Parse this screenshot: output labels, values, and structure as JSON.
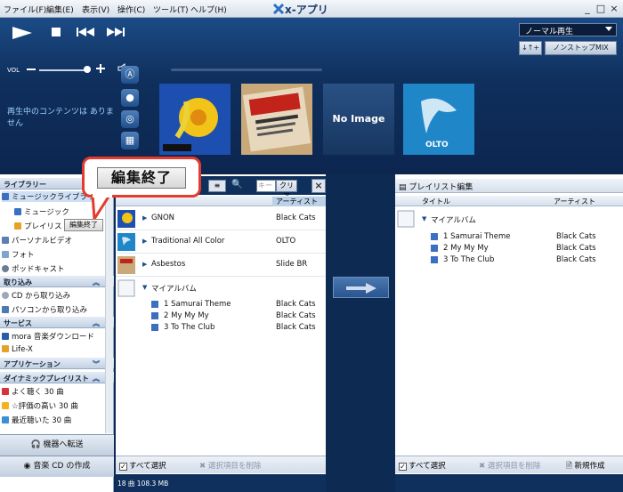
{
  "menubar": {
    "items": [
      "ファイル(F)",
      "編集(E)",
      "表示(V)",
      "操作(C)",
      "ツール(T)",
      "ヘルプ(H)"
    ],
    "app_title": "x-アプリ",
    "window_buttons": [
      "_",
      "□",
      "×"
    ]
  },
  "player": {
    "vol_label": "VOL",
    "play_mode": "ノーマル再生",
    "shuffle_label": "↓↑+",
    "nonstop_label": "ノンストップMIX",
    "now_playing": "再生中のコンテンツは ありません",
    "no_image": "No Image",
    "olto_label": "OLTO"
  },
  "sidebar": {
    "library_header": "ライブラリー",
    "library_items": [
      "ミュージックライブラリー",
      "ミュージック",
      "プレイリスト",
      "パーソナルビデオ",
      "フォト",
      "ポッドキャスト"
    ],
    "import_header": "取り込み",
    "import_items": [
      "CD から取り込み",
      "パソコンから取り込み"
    ],
    "service_header": "サービス",
    "service_items": [
      "mora 音楽ダウンロード",
      "Life-X"
    ],
    "apps_header": "アプリケーション",
    "dynamic_header": "ダイナミックプレイリスト",
    "dynamic_items": [
      "よく聴く 30 曲",
      "☆評価の高い 30 曲",
      "最近聴いた 30 曲"
    ],
    "transfer_button": "機器へ転送",
    "cd_button": "音楽 CD の作成"
  },
  "callout": {
    "big_label": "編集終了",
    "small_label": "編集終了"
  },
  "middle": {
    "search_placeholder": "キー",
    "clear_label": "クリア",
    "column_artist": "アーティスト",
    "rows": [
      {
        "title": "GNON",
        "artist": "Black Cats"
      },
      {
        "title": "Traditional All Color",
        "artist": "OLTO"
      },
      {
        "title": "Asbestos",
        "artist": "Slide BR"
      },
      {
        "title": "マイアルバム",
        "artist": ""
      }
    ],
    "tracks": [
      {
        "title": "1 Samurai Theme",
        "artist": "Black Cats"
      },
      {
        "title": "2 My My My",
        "artist": "Black Cats"
      },
      {
        "title": "3 To The Club",
        "artist": "Black Cats"
      }
    ],
    "select_all": "すべて選択",
    "delete_selected": "選択項目を削除",
    "status": "18 曲  108.3 MB"
  },
  "right": {
    "title": "プレイリスト編集",
    "col_title": "タイトル",
    "col_artist": "アーティスト",
    "album": "マイアルバム",
    "tracks": [
      {
        "title": "1 Samurai Theme",
        "artist": "Black Cats"
      },
      {
        "title": "2 My My My",
        "artist": "Black Cats"
      },
      {
        "title": "3 To The Club",
        "artist": "Black Cats"
      }
    ],
    "select_all": "すべて選択",
    "delete_selected": "選択項目を削除",
    "new_create": "新規作成"
  }
}
